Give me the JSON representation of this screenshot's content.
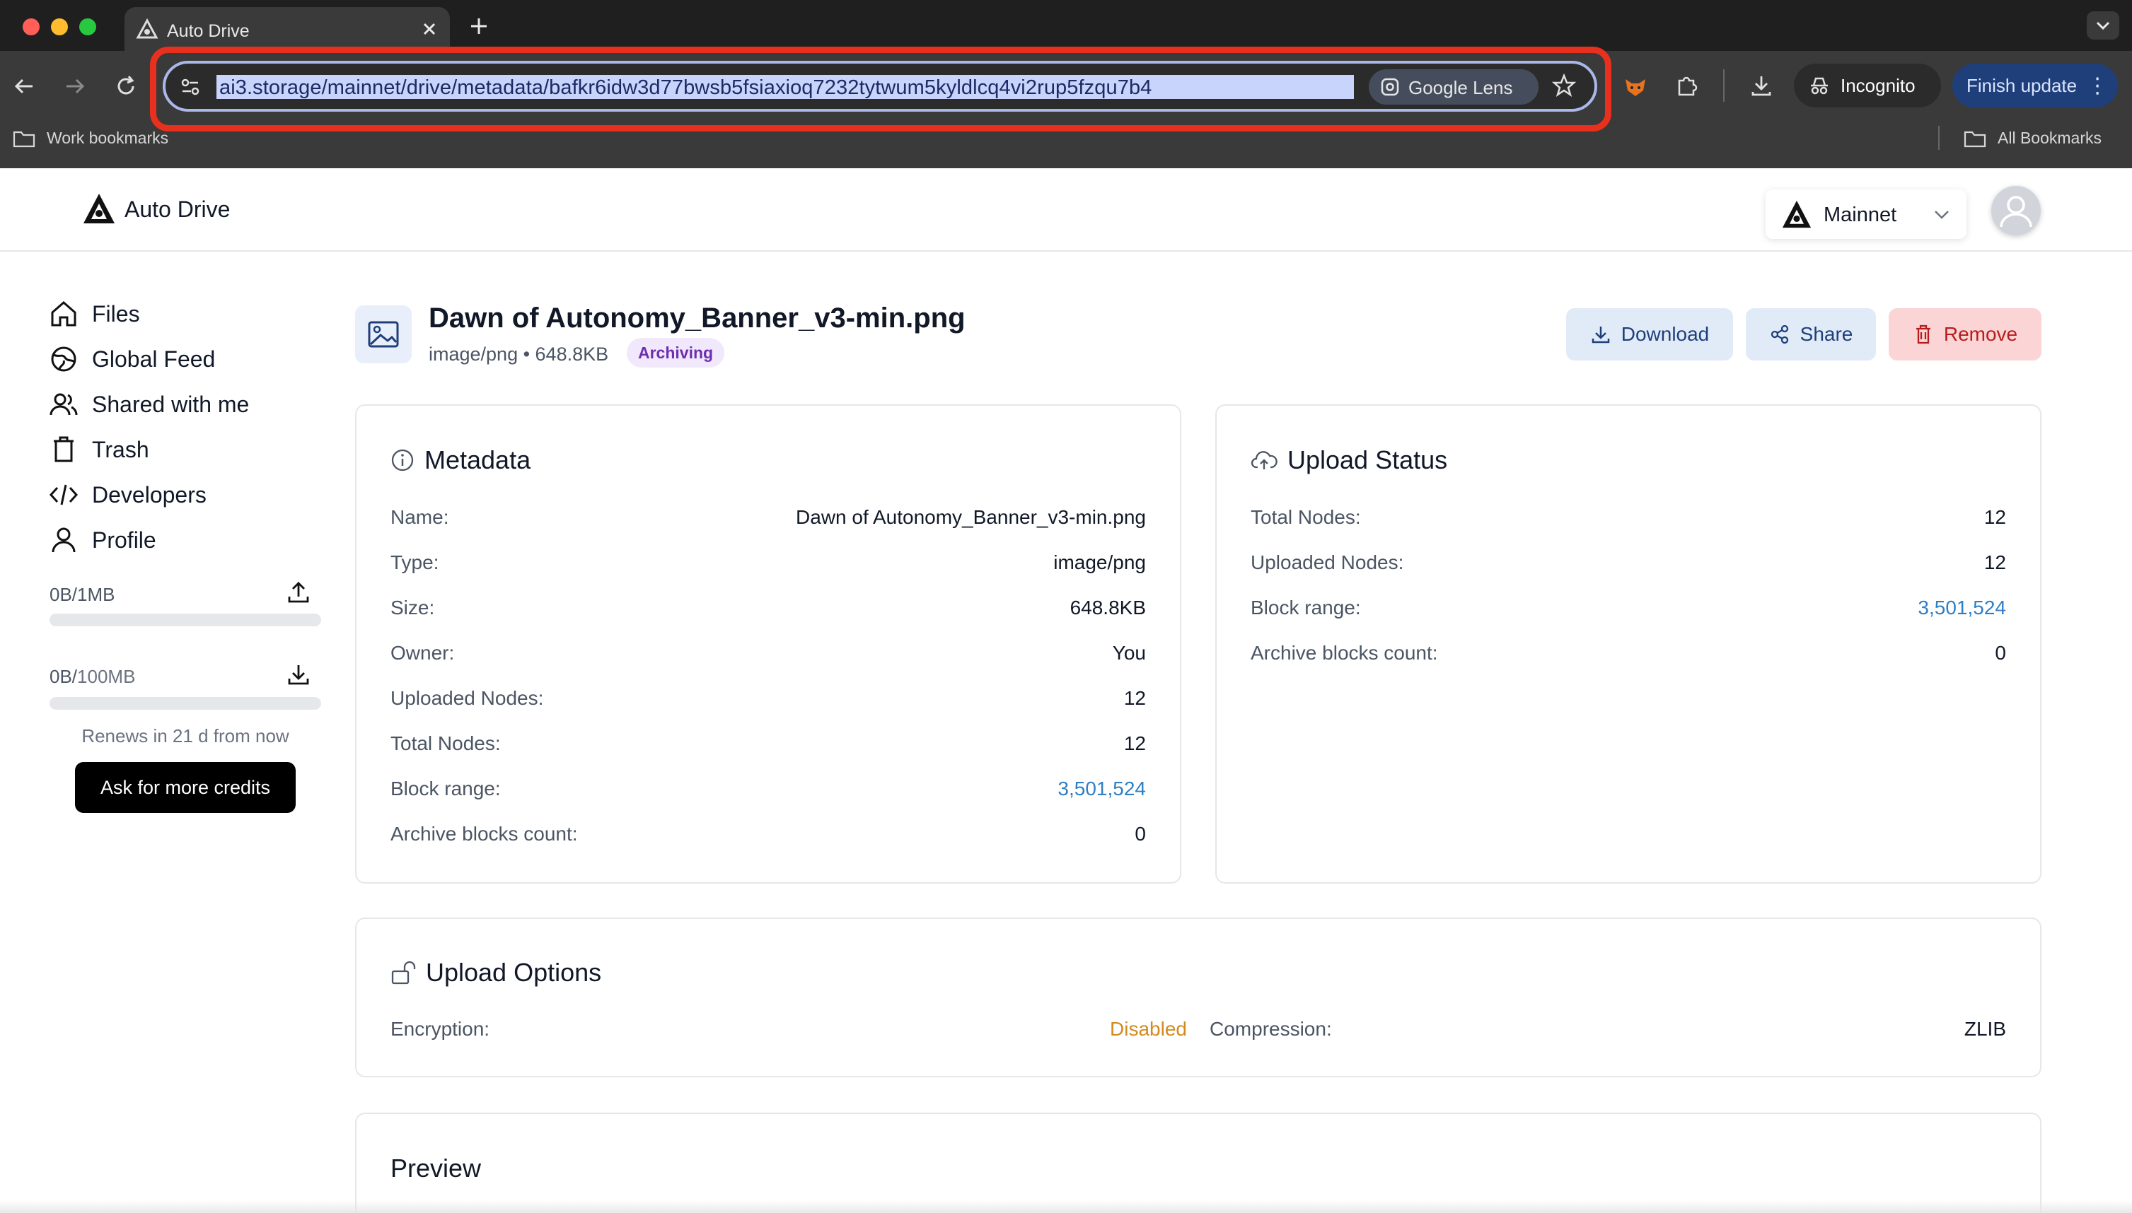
{
  "browser": {
    "tab_title": "Auto Drive",
    "url": "ai3.storage/mainnet/drive/metadata/bafkr6idw3d77bwsb5fsiaxioq7232tytwum5kyldlcq4vi2rup5fzqu7b4",
    "lens_label": "Google Lens",
    "incognito_label": "Incognito",
    "update_label": "Finish update",
    "bookmark_folder": "Work bookmarks",
    "all_bookmarks": "All Bookmarks"
  },
  "app": {
    "brand": "Auto Drive",
    "network": "Mainnet"
  },
  "sidebar": {
    "items": [
      {
        "label": "Files",
        "icon": "home-icon"
      },
      {
        "label": "Global Feed",
        "icon": "globe-icon"
      },
      {
        "label": "Shared with me",
        "icon": "users-icon"
      },
      {
        "label": "Trash",
        "icon": "trash-icon"
      },
      {
        "label": "Developers",
        "icon": "code-icon"
      },
      {
        "label": "Profile",
        "icon": "user-icon"
      }
    ],
    "upload_quota": "0B/1MB",
    "download_quota_used": "0B/",
    "download_quota_total": "100MB",
    "renews": "Renews in 21 d from now",
    "credits_button": "Ask for more credits"
  },
  "file": {
    "title": "Dawn of Autonomy_Banner_v3-min.png",
    "subtitle": "image/png • 648.8KB",
    "badge": "Archiving",
    "actions": {
      "download": "Download",
      "share": "Share",
      "remove": "Remove"
    }
  },
  "metadata": {
    "title": "Metadata",
    "rows": [
      {
        "label": "Name:",
        "value": "Dawn of Autonomy_Banner_v3-min.png"
      },
      {
        "label": "Type:",
        "value": "image/png"
      },
      {
        "label": "Size:",
        "value": "648.8KB"
      },
      {
        "label": "Owner:",
        "value": "You"
      },
      {
        "label": "Uploaded Nodes:",
        "value": "12"
      },
      {
        "label": "Total Nodes:",
        "value": "12"
      },
      {
        "label": "Block range:",
        "value": "3,501,524"
      },
      {
        "label": "Archive blocks count:",
        "value": "0"
      }
    ]
  },
  "upload_status": {
    "title": "Upload Status",
    "rows": [
      {
        "label": "Total Nodes:",
        "value": "12"
      },
      {
        "label": "Uploaded Nodes:",
        "value": "12"
      },
      {
        "label": "Block range:",
        "value": "3,501,524"
      },
      {
        "label": "Archive blocks count:",
        "value": "0"
      }
    ]
  },
  "upload_options": {
    "title": "Upload Options",
    "encryption_label": "Encryption:",
    "encryption_value": "Disabled",
    "compression_label": "Compression:",
    "compression_value": "ZLIB"
  },
  "preview": {
    "title": "Preview"
  },
  "colors": {
    "link": "#2f7fc5",
    "warning": "#d48a1f",
    "accent": "#0b57d0",
    "danger_bg": "#fbd5d5"
  }
}
